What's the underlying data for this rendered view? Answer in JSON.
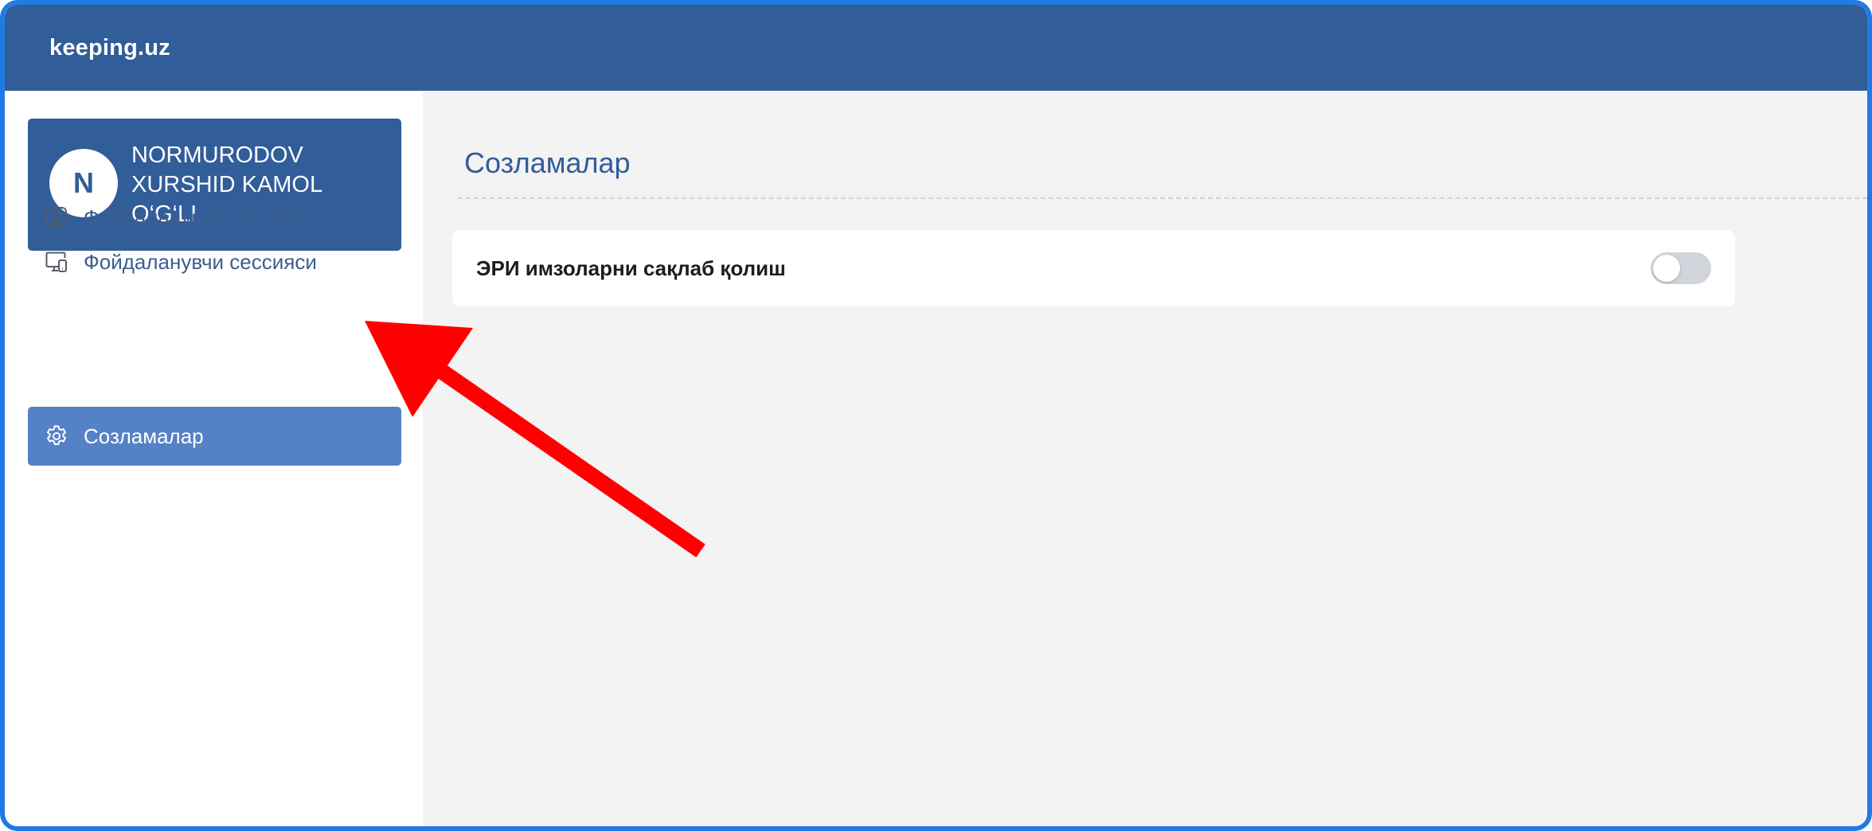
{
  "app": {
    "brand": "keeping.uz"
  },
  "user": {
    "initial": "N",
    "name": "NORMURODOV XURSHID KAMOL O‘G‘LI"
  },
  "sidebar": {
    "items": [
      {
        "label": "Фойдаланувчи профили",
        "icon": "user-profile-icon",
        "active": false
      },
      {
        "label": "Фойдаланувчи сессияси",
        "icon": "devices-icon",
        "active": false
      },
      {
        "label": "Созламалар",
        "icon": "gear-icon",
        "active": true
      }
    ]
  },
  "main": {
    "title": "Созламалар",
    "settings": [
      {
        "label": "ЭРИ имзоларни сақлаб қолиш",
        "enabled": false
      }
    ]
  },
  "colors": {
    "header": "#315d99",
    "active_nav": "#5582c6",
    "frame_border": "#1f7ae6",
    "annotation_arrow": "#ff0000"
  }
}
